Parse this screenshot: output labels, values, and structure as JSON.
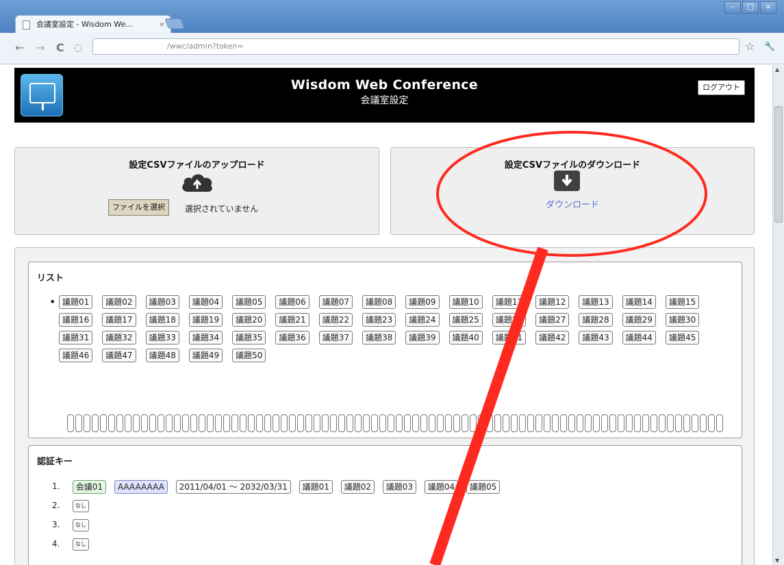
{
  "browser": {
    "tab_title": "会議室設定 - Wisdom We...",
    "tab_close": "×",
    "url": "/wwc/admin?token=",
    "window_controls": [
      "–",
      "□",
      "×"
    ],
    "nav_back": "←",
    "nav_forward": "→",
    "nav_reload": "C",
    "bookmark_star": "☆",
    "wrench": "🔧"
  },
  "header": {
    "title": "Wisdom Web Conference",
    "subtitle": "会議室設定",
    "logout_label": "ログアウト"
  },
  "upload_panel": {
    "title": "設定CSVファイルのアップロード",
    "file_button": "ファイルを選択",
    "file_status": "選択されていません"
  },
  "download_panel": {
    "title": "設定CSVファイルのダウンロード",
    "link": "ダウンロード"
  },
  "list_section": {
    "title": "リスト",
    "bullet": "•",
    "items": [
      "議題01",
      "議題02",
      "議題03",
      "議題04",
      "議題05",
      "議題06",
      "議題07",
      "議題08",
      "議題09",
      "議題10",
      "議題11",
      "議題12",
      "議題13",
      "議題14",
      "議題15",
      "議題16",
      "議題17",
      "議題18",
      "議題19",
      "議題20",
      "議題21",
      "議題22",
      "議題23",
      "議題24",
      "議題25",
      "議題26",
      "議題27",
      "議題28",
      "議題29",
      "議題30",
      "議題31",
      "議題32",
      "議題33",
      "議題34",
      "議題35",
      "議題36",
      "議題37",
      "議題38",
      "議題39",
      "議題40",
      "議題41",
      "議題42",
      "議題43",
      "議題44",
      "議題45",
      "議題46",
      "議題47",
      "議題48",
      "議題49",
      "議題50"
    ]
  },
  "auth_section": {
    "title": "認証キー",
    "rows": [
      {
        "num": "1.",
        "room": "会議01",
        "key": "AAAAAAAA",
        "period": "2011/04/01 ～ 2032/03/31",
        "topics": [
          "議題01",
          "議題02",
          "議題03",
          "議題04",
          "議題05"
        ]
      },
      {
        "num": "2.",
        "label": "なし"
      },
      {
        "num": "3.",
        "label": "なし"
      },
      {
        "num": "4.",
        "label": "なし"
      }
    ]
  },
  "colors": {
    "annotation": "#ff2a1f",
    "header_bg": "#000000",
    "link": "#5a6fd0"
  }
}
